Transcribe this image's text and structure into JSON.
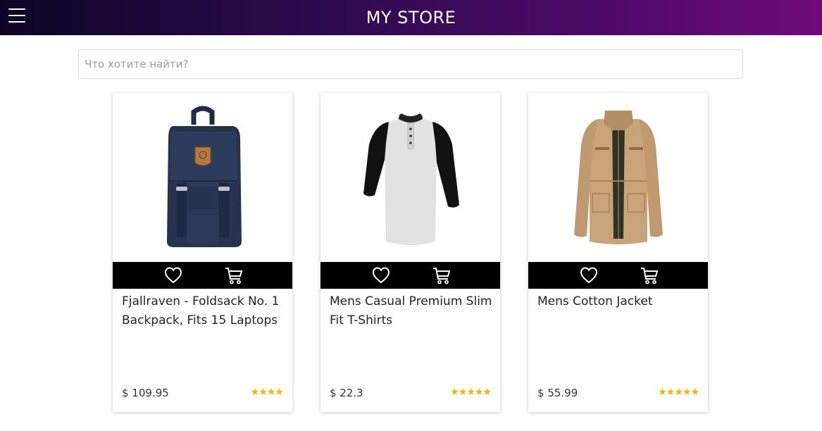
{
  "header": {
    "menu_icon": "hamburger-menu-icon",
    "title": "MY STORE"
  },
  "search": {
    "placeholder": "Что хотите найти?",
    "value": ""
  },
  "colors": {
    "header_gradient_start": "#0d0425",
    "header_gradient_end": "#6e0a7c",
    "action_bar": "#000000",
    "rating_star": "#f5b400"
  },
  "products": [
    {
      "title": "Fjallraven - Foldsack No. 1 Backpack, Fits 15 Laptops",
      "price": "$ 109.95",
      "rating": 4,
      "rating_text": "★★★★",
      "image": "backpack-image",
      "actions": [
        "heart-icon",
        "shopping-cart-icon"
      ]
    },
    {
      "title": "Mens Casual Premium Slim Fit T-Shirts",
      "price": "$ 22.3",
      "rating": 5,
      "rating_text": "★★★★★",
      "image": "tshirt-image",
      "actions": [
        "heart-icon",
        "shopping-cart-icon"
      ]
    },
    {
      "title": "Mens Cotton Jacket",
      "price": "$ 55.99",
      "rating": 5,
      "rating_text": "★★★★★",
      "image": "jacket-image",
      "actions": [
        "heart-icon",
        "shopping-cart-icon"
      ]
    }
  ]
}
